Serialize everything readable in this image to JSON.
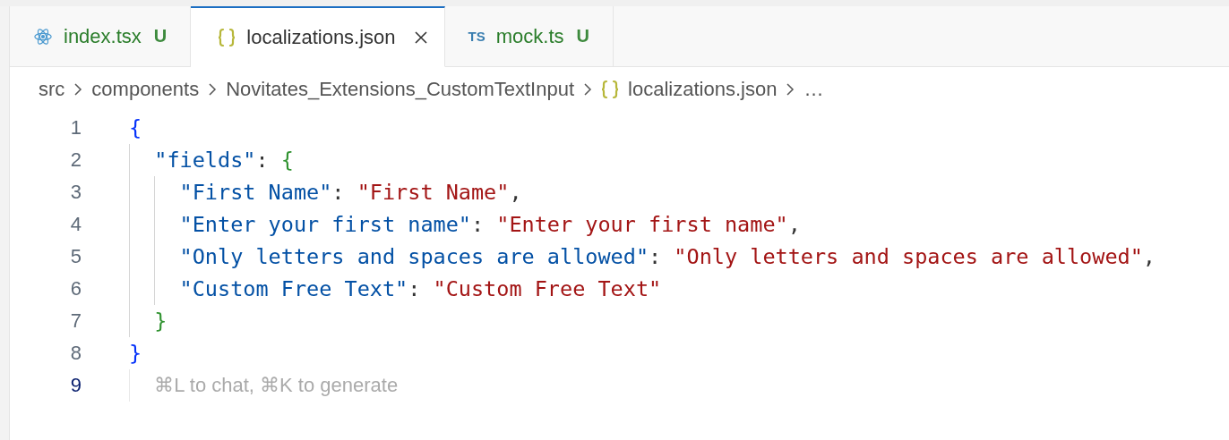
{
  "tabs": [
    {
      "label": "index.tsx",
      "kind": "react",
      "status": "U",
      "selected": false
    },
    {
      "label": "localizations.json",
      "kind": "json",
      "selected": true,
      "closable": true
    },
    {
      "label": "mock.ts",
      "kind": "ts",
      "icon_text": "TS",
      "status": "U",
      "selected": false
    }
  ],
  "breadcrumb": [
    {
      "label": "src"
    },
    {
      "label": "components"
    },
    {
      "label": "Novitates_Extensions_CustomTextInput"
    },
    {
      "label": "localizations.json",
      "kind": "json"
    },
    {
      "label": "…"
    }
  ],
  "lines": [
    {
      "number": "1",
      "current": false,
      "tokens": [
        {
          "kind": "brace",
          "text": "{"
        }
      ],
      "children": [
        {
          "number": "2",
          "current": false,
          "tokens": [
            {
              "kind": "key",
              "text": "\"fields\""
            },
            {
              "kind": "punct",
              "text": ": "
            },
            {
              "kind": "brace2",
              "text": "{"
            }
          ],
          "children": [
            {
              "number": "3",
              "current": false,
              "tokens": [
                {
                  "kind": "key",
                  "text": "\"First Name\""
                },
                {
                  "kind": "punct",
                  "text": ": "
                },
                {
                  "kind": "string",
                  "text": "\"First Name\""
                },
                {
                  "kind": "punct",
                  "text": ","
                }
              ]
            },
            {
              "number": "4",
              "current": false,
              "tokens": [
                {
                  "kind": "key",
                  "text": "\"Enter your first name\""
                },
                {
                  "kind": "punct",
                  "text": ": "
                },
                {
                  "kind": "string",
                  "text": "\"Enter your first name\""
                },
                {
                  "kind": "punct",
                  "text": ","
                }
              ]
            },
            {
              "number": "5",
              "current": false,
              "tokens": [
                {
                  "kind": "key",
                  "text": "\"Only letters and spaces are allowed\""
                },
                {
                  "kind": "punct",
                  "text": ": "
                },
                {
                  "kind": "string",
                  "text": "\"Only letters and spaces are allowed\""
                },
                {
                  "kind": "punct",
                  "text": ","
                }
              ]
            },
            {
              "number": "6",
              "current": false,
              "tokens": [
                {
                  "kind": "key",
                  "text": "\"Custom Free Text\""
                },
                {
                  "kind": "punct",
                  "text": ": "
                },
                {
                  "kind": "string",
                  "text": "\"Custom Free Text\""
                }
              ]
            }
          ]
        },
        {
          "number": "7",
          "current": false,
          "tokens": [
            {
              "kind": "brace2",
              "text": "}"
            }
          ]
        }
      ]
    },
    {
      "number": "8",
      "current": false,
      "tokens": [
        {
          "kind": "brace",
          "text": "}"
        }
      ]
    },
    {
      "number": "9",
      "current": true,
      "kind": "hint",
      "tokens": [
        {
          "kind": "hint",
          "text": "⌘L to chat, ⌘K to generate"
        }
      ]
    }
  ]
}
